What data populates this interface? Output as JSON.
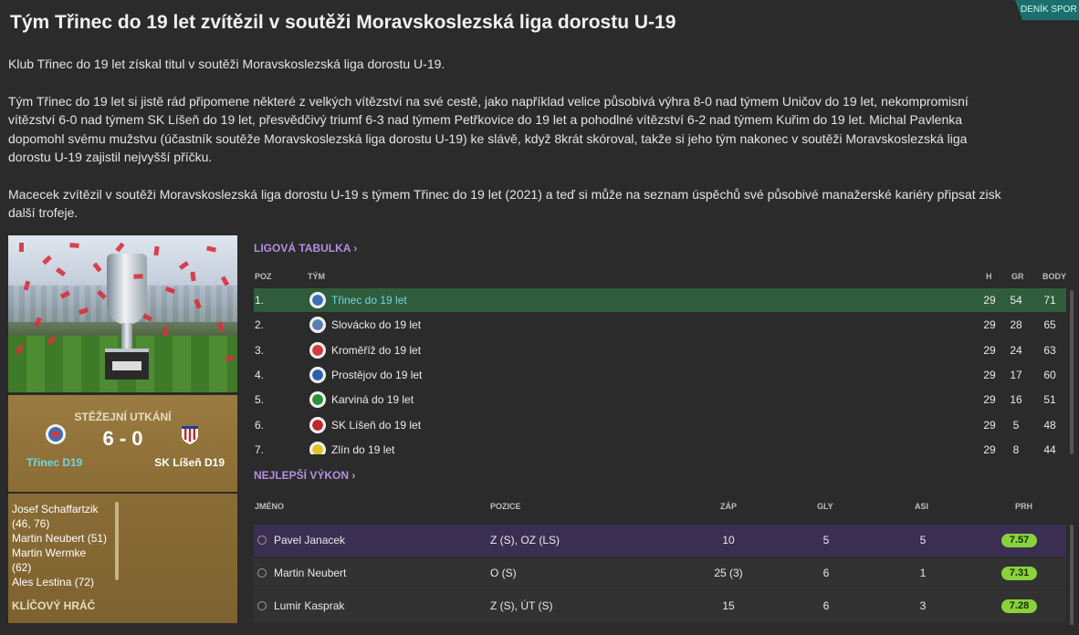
{
  "corner_tag": "DENÍK SPOR",
  "title": "Tým Třinec do 19 let zvítězil v soutěži Moravskoslezská liga dorostu U-19",
  "article": {
    "p1": "Klub Třinec do 19 let získal titul v soutěži Moravskoslezská liga dorostu U-19.",
    "p2_l1": "Tým Třinec do 19 let si jistě rád připomene některé z velkých vítězství na své cestě, jako například velice působivá výhra 8-0 nad týmem Uničov do 19 let, nekompromisní",
    "p2_l2": "vítězství 6-0 nad týmem SK Líšeň do 19 let, přesvědčivý triumf 6-3 nad týmem Petřkovice do 19 let a pohodlné vítězství 6-2 nad týmem Kuřim do 19 let. Michal Pavlenka",
    "p2_l3": "dopomohl svému mužstvu (účastník soutěže Moravskoslezská liga dorostu U-19) ke slávě, když 8krát skóroval, takže si jeho tým nakonec v soutěži Moravskoslezská liga",
    "p2_l4": "dorostu U-19 zajistil nejvyšší příčku.",
    "p3_l1": "Macecek zvítězil v soutěži Moravskoslezská liga dorostu U-19 s týmem Třinec do 19 let (2021) a teď si může na seznam úspěchů své působivé manažerské kariéry připsat zisk",
    "p3_l2": "další trofeje."
  },
  "key_match": {
    "label": "STĚŽEJNÍ UTKÁNÍ",
    "score": "6 - 0",
    "home": "Třinec D19",
    "away": "SK Líšeň D19",
    "scorers": [
      "Josef Schaffartzik",
      "(46, 76)",
      "Martin Neubert (51)",
      "Martin Wermke",
      "(62)",
      "Ales Lestina (72)"
    ],
    "key_player_label": "KLÍČOVÝ HRÁČ"
  },
  "league": {
    "link": "LIGOVÁ TABULKA",
    "headers": {
      "pos": "POZ",
      "team": "TÝM",
      "h": "H",
      "gr": "GR",
      "pts": "BODY"
    },
    "rows": [
      {
        "pos": "1.",
        "team": "Třinec do 19 let",
        "h": "29",
        "gr": "54",
        "pts": "71",
        "color": "#3b6fb8"
      },
      {
        "pos": "2.",
        "team": "Slovácko do 19 let",
        "h": "29",
        "gr": "28",
        "pts": "65",
        "color": "#5a7fb0"
      },
      {
        "pos": "3.",
        "team": "Kroměříž do 19 let",
        "h": "29",
        "gr": "24",
        "pts": "63",
        "color": "#d33a3a"
      },
      {
        "pos": "4.",
        "team": "Prostějov do 19 let",
        "h": "29",
        "gr": "17",
        "pts": "60",
        "color": "#2d5fb0"
      },
      {
        "pos": "5.",
        "team": "Karviná do 19 let",
        "h": "29",
        "gr": "16",
        "pts": "51",
        "color": "#2b8f3d"
      },
      {
        "pos": "6.",
        "team": "SK Líšeň do 19 let",
        "h": "29",
        "gr": "5",
        "pts": "48",
        "color": "#c0282d"
      },
      {
        "pos": "7.",
        "team": "Zlín do 19 let",
        "h": "29",
        "gr": "8",
        "pts": "44",
        "color": "#e2c12a"
      }
    ]
  },
  "performance": {
    "link": "NEJLEPŠÍ VÝKON",
    "headers": {
      "name": "JMÉNO",
      "position": "POZICE",
      "apps": "ZÁP",
      "goals": "GLY",
      "assists": "ASI",
      "rating": "PRH"
    },
    "rows": [
      {
        "name": "Pavel Janacek",
        "position": "Z (S), OZ (LS)",
        "apps": "10",
        "goals": "5",
        "assists": "5",
        "rating": "7.57"
      },
      {
        "name": "Martin Neubert",
        "position": "O (S)",
        "apps": "25 (3)",
        "goals": "6",
        "assists": "1",
        "rating": "7.31"
      },
      {
        "name": "Lumir Kasprak",
        "position": "Z (S), ÚT (S)",
        "apps": "15",
        "goals": "6",
        "assists": "3",
        "rating": "7.28"
      }
    ]
  }
}
